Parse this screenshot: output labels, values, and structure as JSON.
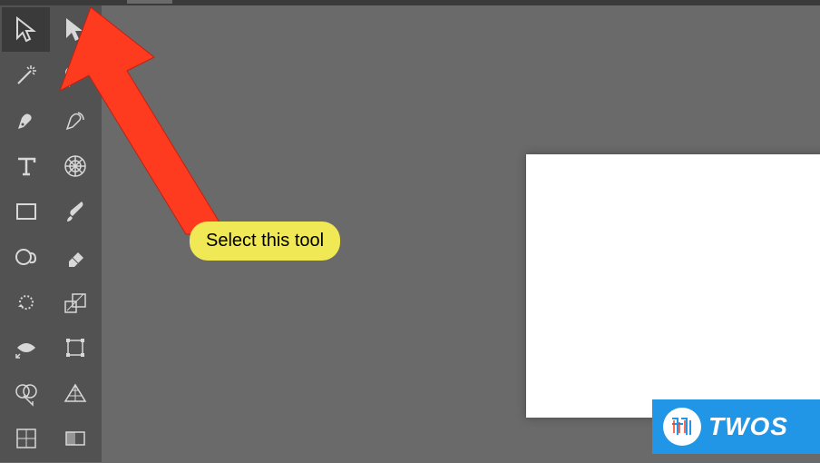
{
  "annotation": {
    "label": "Select this tool",
    "color": "#f0e854",
    "arrow_color": "#ff3b1f"
  },
  "watermark": {
    "text": "TWOS",
    "background": "#2296e6"
  },
  "toolbar": {
    "selected_tool": "selection-tool"
  },
  "canvas": {
    "background": "#ffffff"
  }
}
